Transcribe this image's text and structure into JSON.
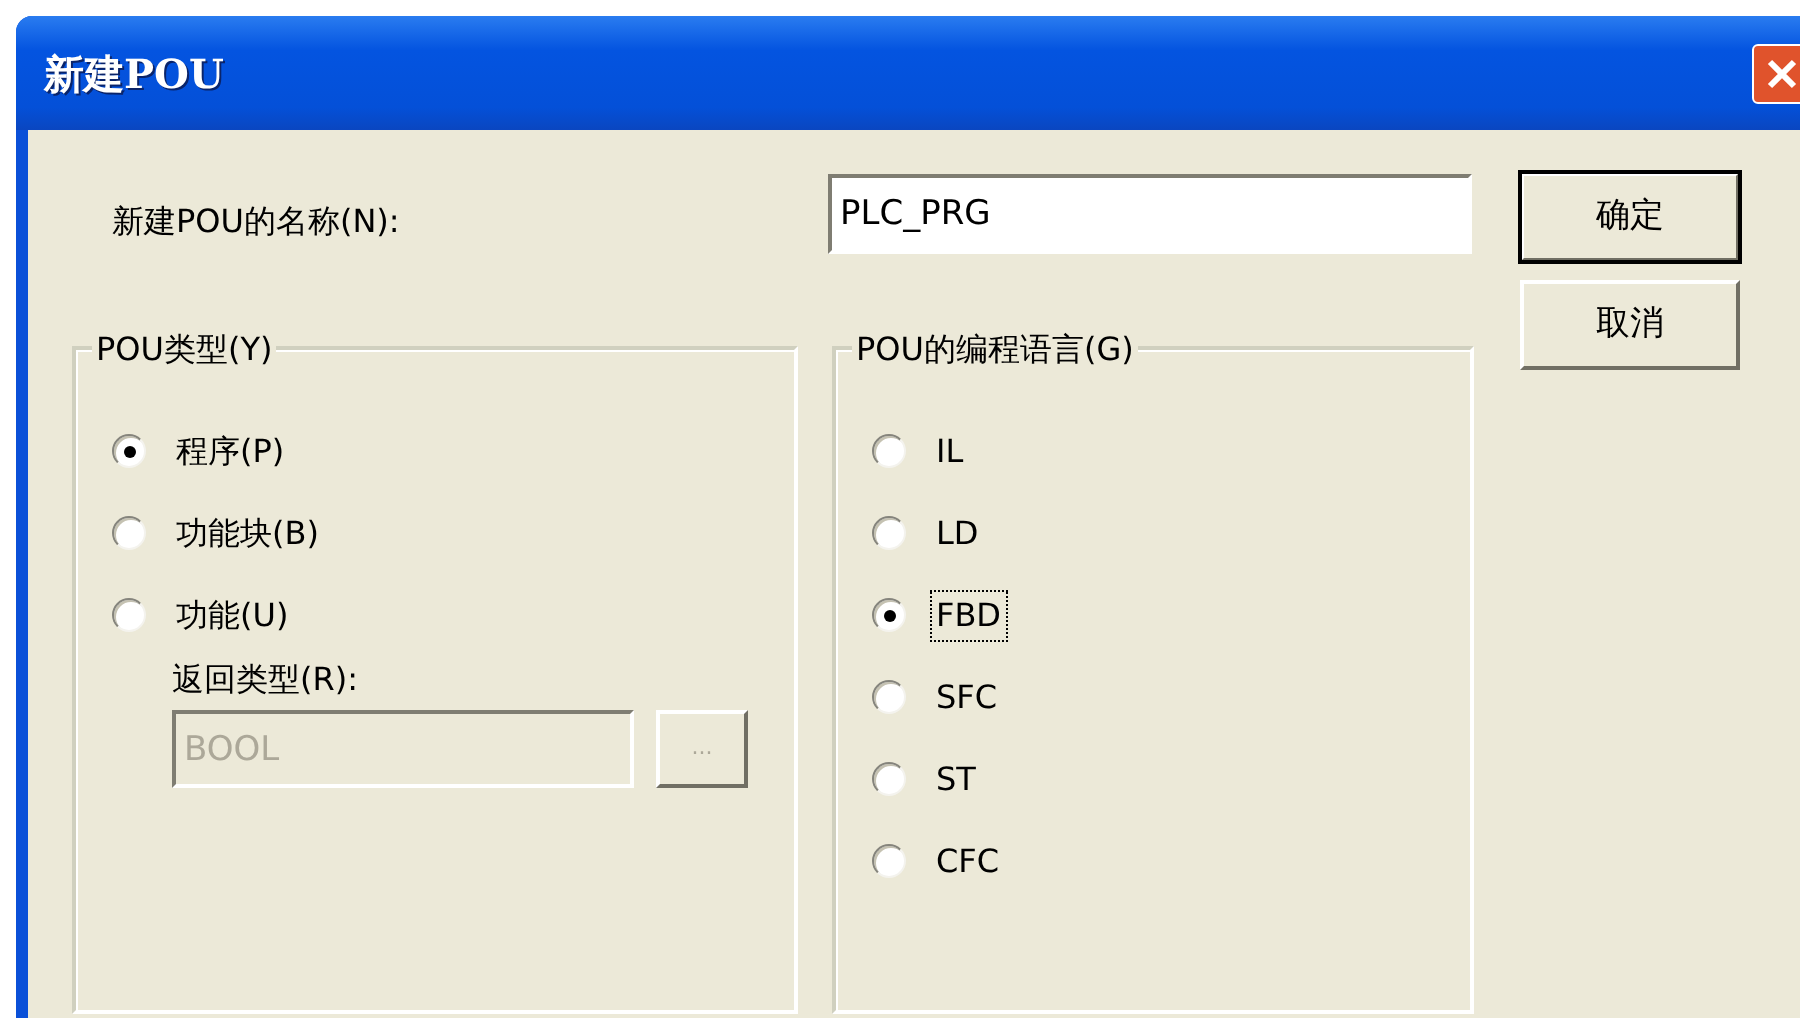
{
  "window": {
    "title": "新建POU"
  },
  "name_field": {
    "label": "新建POU的名称(N):",
    "value": "PLC_PRG"
  },
  "buttons": [
    {
      "label": "确定",
      "default": true
    },
    {
      "label": "取消",
      "default": false
    }
  ],
  "pou_type": {
    "title": "POU类型(Y)",
    "options": [
      {
        "label": "程序(P)",
        "selected": true
      },
      {
        "label": "功能块(B)",
        "selected": false
      },
      {
        "label": "功能(U)",
        "selected": false
      }
    ],
    "return_type": {
      "label": "返回类型(R):",
      "value": "BOOL",
      "disabled": true,
      "browse": "..."
    }
  },
  "language": {
    "title": "POU的编程语言(G)",
    "options": [
      {
        "label": "IL",
        "selected": false,
        "focused": false
      },
      {
        "label": "LD",
        "selected": false,
        "focused": false
      },
      {
        "label": "FBD",
        "selected": true,
        "focused": true
      },
      {
        "label": "SFC",
        "selected": false,
        "focused": false
      },
      {
        "label": "ST",
        "selected": false,
        "focused": false
      },
      {
        "label": "CFC",
        "selected": false,
        "focused": false
      }
    ]
  }
}
